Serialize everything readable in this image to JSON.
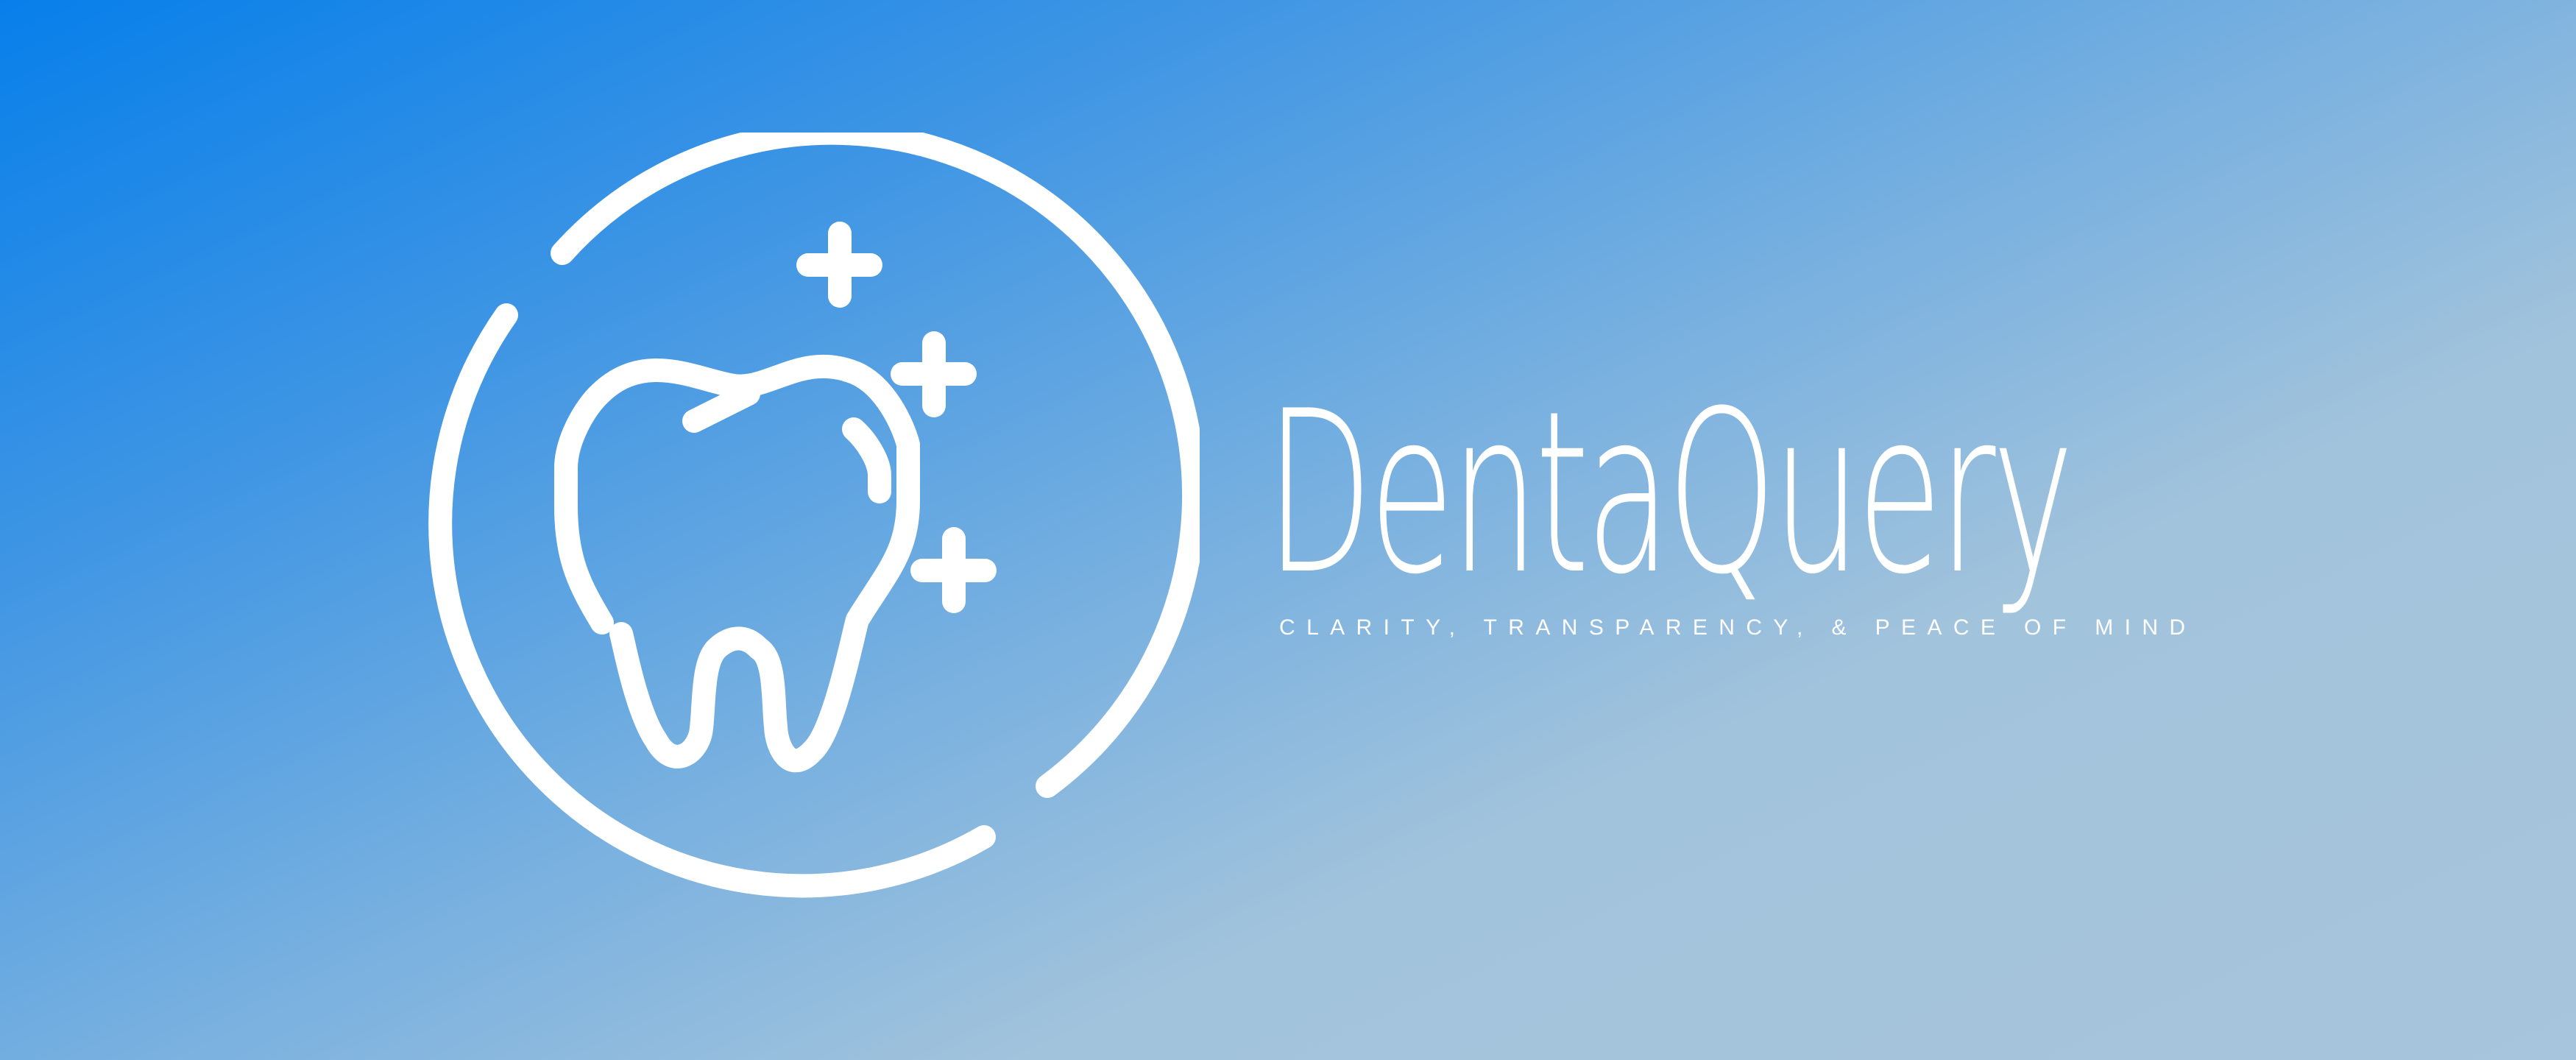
{
  "brand": {
    "name": "DentaQuery",
    "tagline": "CLARITY, TRANSPARENCY, & PEACE OF MIND"
  },
  "logo": {
    "icon": "tooth-with-sparkles-icon",
    "stroke_color": "#ffffff"
  },
  "colors": {
    "gradient_start": "#077fea",
    "gradient_end": "#a7c5dc",
    "text": "#ffffff"
  }
}
